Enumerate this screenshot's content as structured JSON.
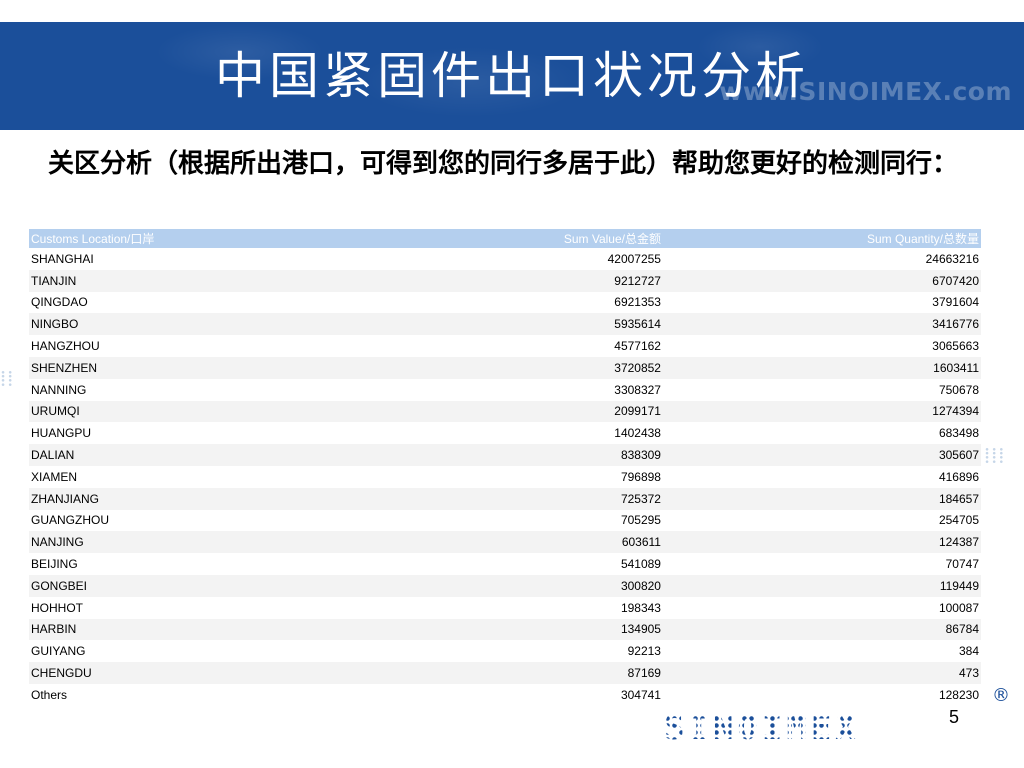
{
  "slide": {
    "title": "中国紧固件出口状况分析",
    "watermark": "www.SINOIMEX.com",
    "subtitle": "关区分析（根据所出港口，可得到您的同行多居于此）帮助您更好的检测同行：",
    "page_number": "5",
    "logo_text": "SINOIMEX",
    "registered_mark": "®",
    "brand_color": "#1b4f9a",
    "table_header_color": "#b4cfee"
  },
  "table": {
    "headers": {
      "location": "Customs Location/口岸",
      "value": "Sum Value/总金额",
      "quantity": "Sum Quantity/总数量"
    },
    "rows": [
      {
        "location": "SHANGHAI",
        "value": "42007255",
        "quantity": "24663216"
      },
      {
        "location": "TIANJIN",
        "value": "9212727",
        "quantity": "6707420"
      },
      {
        "location": "QINGDAO",
        "value": "6921353",
        "quantity": "3791604"
      },
      {
        "location": "NINGBO",
        "value": "5935614",
        "quantity": "3416776"
      },
      {
        "location": "HANGZHOU",
        "value": "4577162",
        "quantity": "3065663"
      },
      {
        "location": "SHENZHEN",
        "value": "3720852",
        "quantity": "1603411"
      },
      {
        "location": "NANNING",
        "value": "3308327",
        "quantity": "750678"
      },
      {
        "location": "URUMQI",
        "value": "2099171",
        "quantity": "1274394"
      },
      {
        "location": "HUANGPU",
        "value": "1402438",
        "quantity": "683498"
      },
      {
        "location": "DALIAN",
        "value": "838309",
        "quantity": "305607"
      },
      {
        "location": "XIAMEN",
        "value": "796898",
        "quantity": "416896"
      },
      {
        "location": "ZHANJIANG",
        "value": "725372",
        "quantity": "184657"
      },
      {
        "location": "GUANGZHOU",
        "value": "705295",
        "quantity": "254705"
      },
      {
        "location": "NANJING",
        "value": "603611",
        "quantity": "124387"
      },
      {
        "location": "BEIJING",
        "value": "541089",
        "quantity": "70747"
      },
      {
        "location": "GONGBEI",
        "value": "300820",
        "quantity": "119449"
      },
      {
        "location": "HOHHOT",
        "value": "198343",
        "quantity": "100087"
      },
      {
        "location": "HARBIN",
        "value": "134905",
        "quantity": "86784"
      },
      {
        "location": "GUIYANG",
        "value": "92213",
        "quantity": "384"
      },
      {
        "location": "CHENGDU",
        "value": "87169",
        "quantity": "473"
      },
      {
        "location": "Others",
        "value": "304741",
        "quantity": "128230"
      }
    ]
  }
}
